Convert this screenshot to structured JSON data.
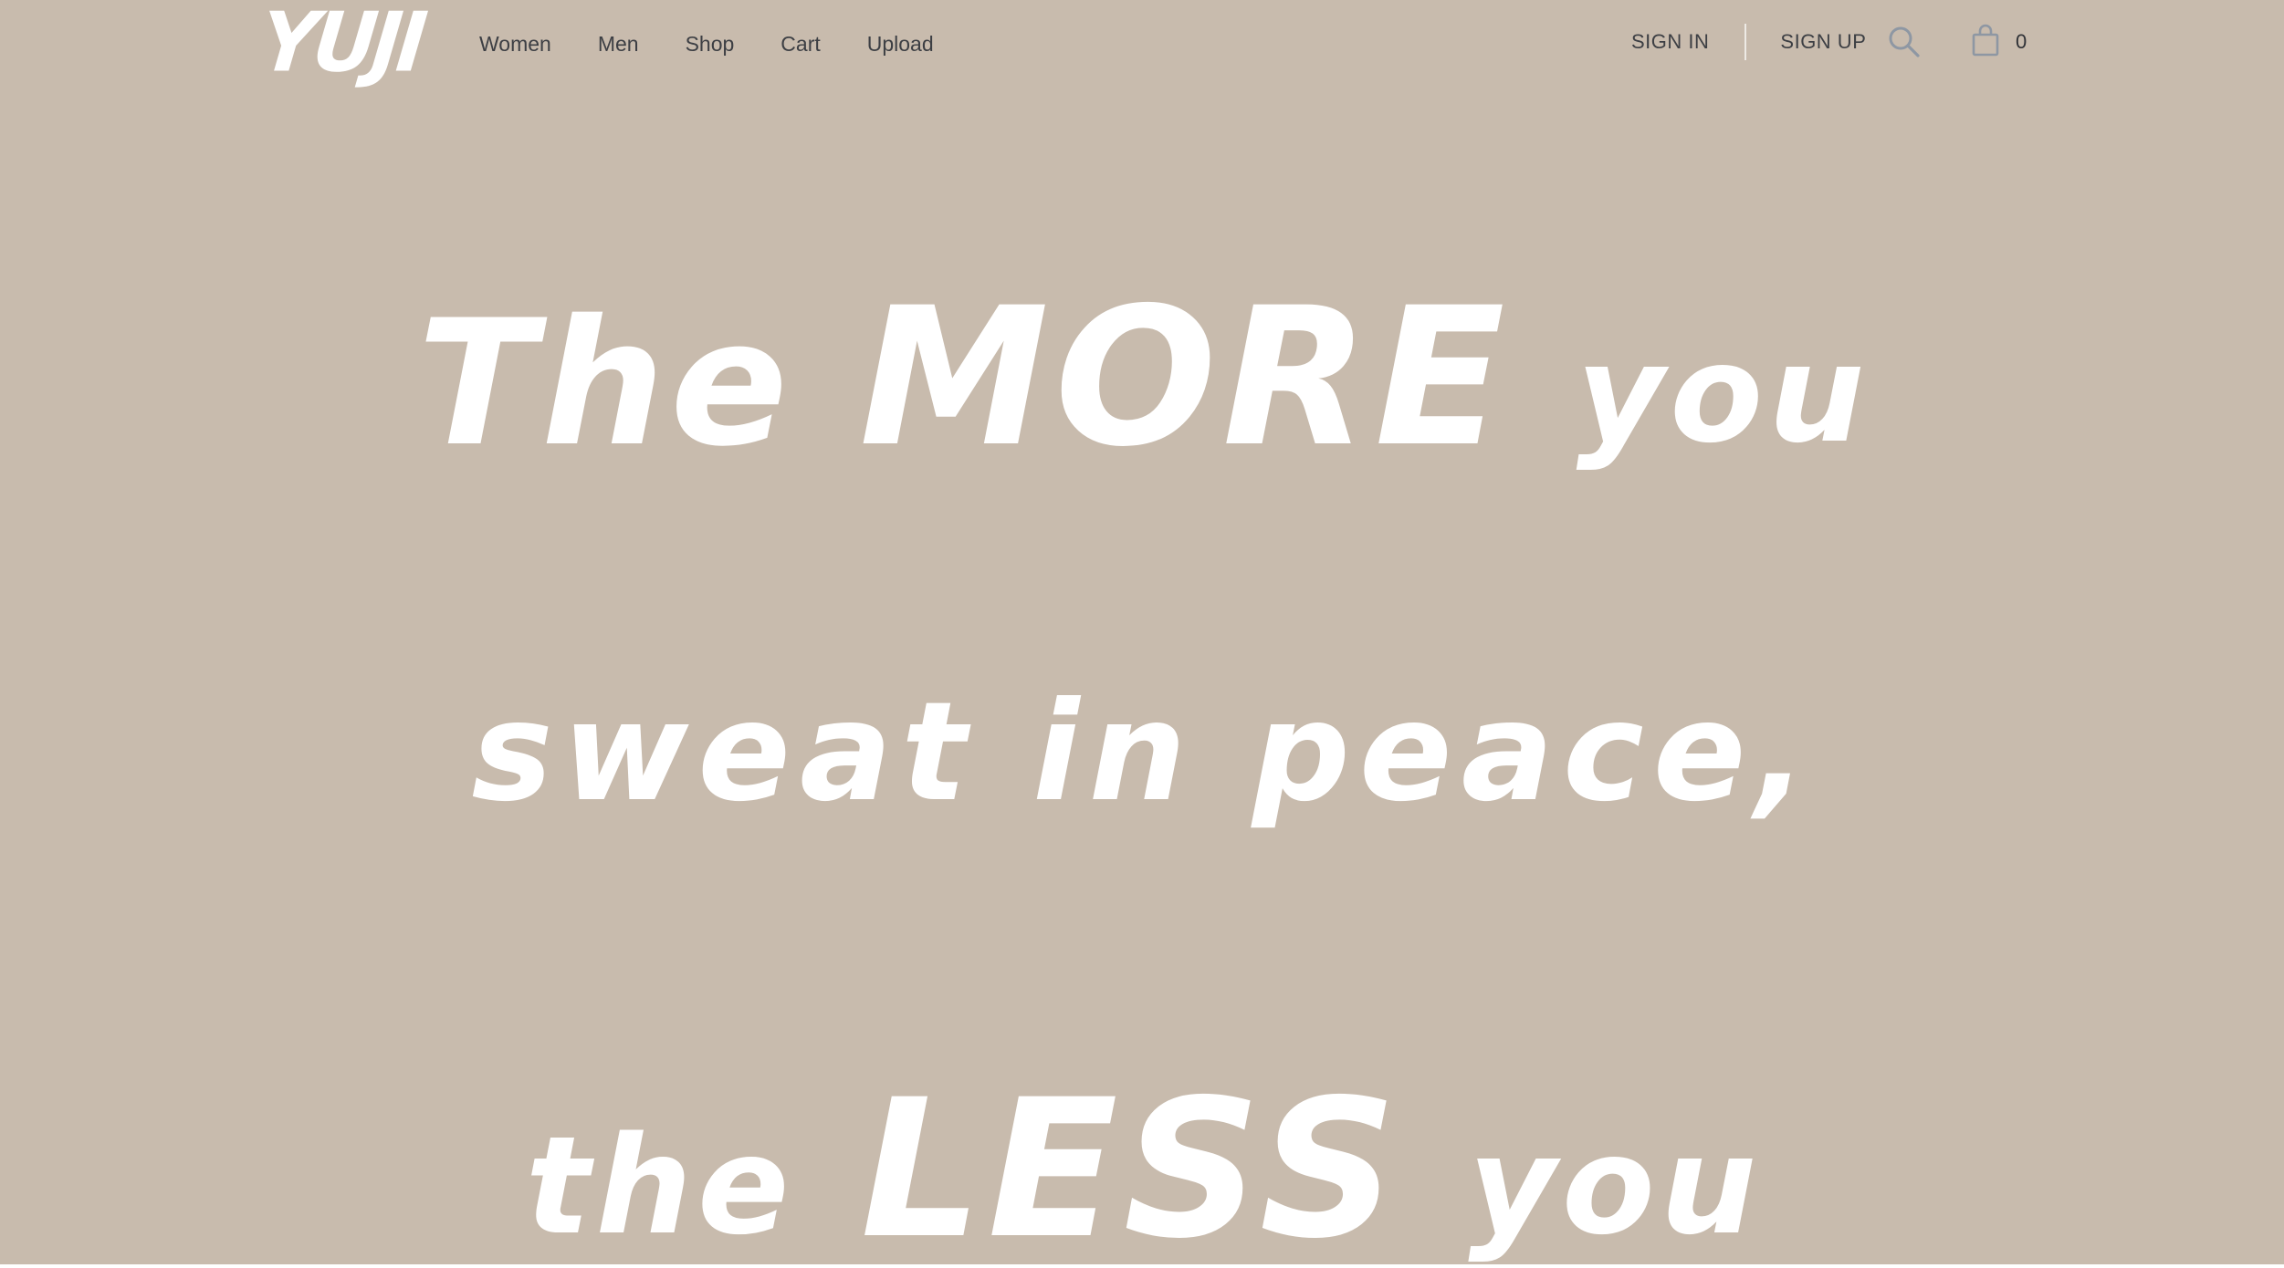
{
  "header": {
    "logo_text": "YUJI",
    "nav": [
      {
        "label": "Women"
      },
      {
        "label": "Men"
      },
      {
        "label": "Shop"
      },
      {
        "label": "Cart"
      },
      {
        "label": "Upload"
      }
    ],
    "sign_in_label": "SIGN IN",
    "sign_up_label": "SIGN UP",
    "search_icon": "search-icon",
    "cart_icon": "shopping-bag-icon",
    "cart_count": "0"
  },
  "hero": {
    "line1": {
      "w1": "The",
      "w2": "MORE",
      "w3": "you"
    },
    "line2": "sweat in peace,",
    "line3": {
      "w1": "the",
      "w2": "LESS",
      "w3": "you"
    }
  },
  "colors": {
    "background": "#c8bbad",
    "hero_text": "#ffffff",
    "nav_text": "#3d3f44",
    "icon": "#8e97a3"
  }
}
